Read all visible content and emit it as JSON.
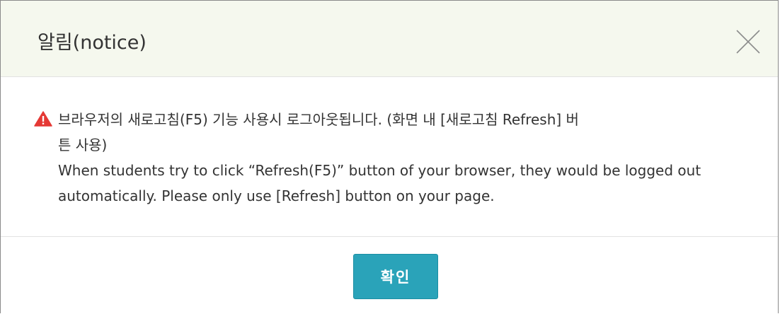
{
  "dialog": {
    "title": "알림(notice)",
    "close_icon": "close-icon",
    "warning_icon": "warning-triangle-icon",
    "message_ko_line1": "브라우저의 새로고침(F5) 기능 사용시 로그아웃됩니다. (화면 내 [새로고침 Refresh] 버",
    "message_ko_line2": "튼 사용)",
    "message_en": "When students try to click “Refresh(F5)” button of your browser, they would be logged out automatically. Please only use [Refresh] button on your page.",
    "ok_label": "확인"
  },
  "colors": {
    "header_bg": "#f5f8ee",
    "warning": "#e53935",
    "button": "#2aa3b9"
  }
}
